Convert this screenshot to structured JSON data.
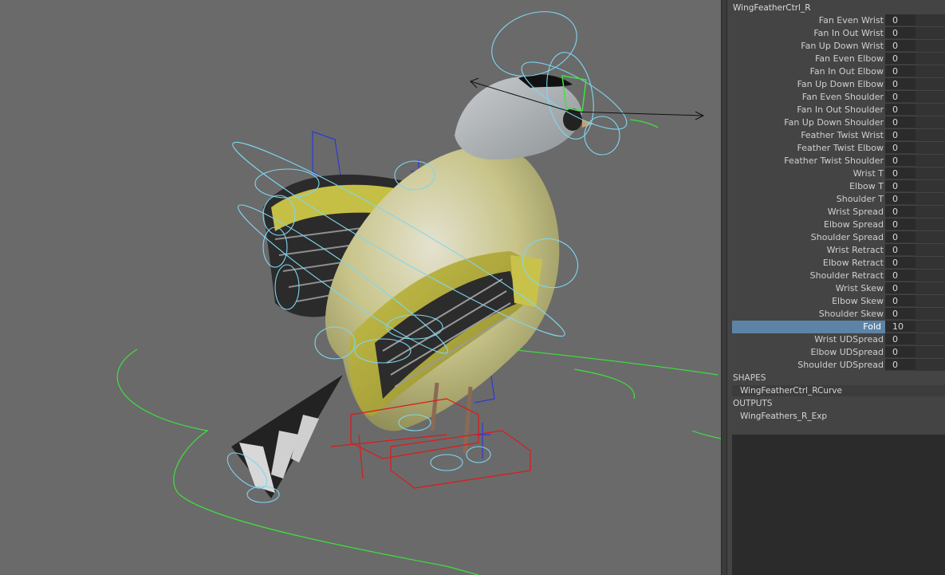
{
  "channel_box": {
    "node_name": "WingFeatherCtrl_R",
    "attributes": [
      {
        "label": "Fan Even Wrist",
        "value": "0"
      },
      {
        "label": "Fan In Out Wrist",
        "value": "0"
      },
      {
        "label": "Fan Up Down Wrist",
        "value": "0"
      },
      {
        "label": "Fan Even Elbow",
        "value": "0"
      },
      {
        "label": "Fan In Out Elbow",
        "value": "0"
      },
      {
        "label": "Fan Up Down Elbow",
        "value": "0"
      },
      {
        "label": "Fan Even Shoulder",
        "value": "0"
      },
      {
        "label": "Fan In Out Shoulder",
        "value": "0"
      },
      {
        "label": "Fan Up Down Shoulder",
        "value": "0"
      },
      {
        "label": "Feather Twist Wrist",
        "value": "0"
      },
      {
        "label": "Feather Twist Elbow",
        "value": "0"
      },
      {
        "label": "Feather Twist Shoulder",
        "value": "0"
      },
      {
        "label": "Wrist T",
        "value": "0"
      },
      {
        "label": "Elbow T",
        "value": "0"
      },
      {
        "label": "Shoulder T",
        "value": "0"
      },
      {
        "label": "Wrist Spread",
        "value": "0"
      },
      {
        "label": "Elbow Spread",
        "value": "0"
      },
      {
        "label": "Shoulder Spread",
        "value": "0"
      },
      {
        "label": "Wrist Retract",
        "value": "0"
      },
      {
        "label": "Elbow Retract",
        "value": "0"
      },
      {
        "label": "Shoulder Retract",
        "value": "0"
      },
      {
        "label": "Wrist Skew",
        "value": "0"
      },
      {
        "label": "Elbow Skew",
        "value": "0"
      },
      {
        "label": "Shoulder Skew",
        "value": "0"
      },
      {
        "label": "Fold",
        "value": "10",
        "selected": true
      },
      {
        "label": "Wrist UDSpread",
        "value": "0"
      },
      {
        "label": "Elbow UDSpread",
        "value": "0"
      },
      {
        "label": "Shoulder UDSpread",
        "value": "0"
      }
    ],
    "shapes_header": "SHAPES",
    "shapes": [
      "WingFeatherCtrl_RCurve"
    ],
    "outputs_header": "OUTPUTS",
    "outputs": [
      "WingFeathers_R_Exp"
    ]
  },
  "colors": {
    "viewport_bg": "#6a6a6a",
    "panel_bg": "#444444",
    "field_bg": "#2b2b2b",
    "selected_attr": "#5c84a6",
    "control_curve": "#7fd6f0",
    "selected_curve_green": "#3ee23e",
    "locator_blue": "#2a3bd6",
    "foot_ctrl_red": "#e01818"
  },
  "viewport": {
    "content": "3d-bird-rig-goldfinch"
  }
}
